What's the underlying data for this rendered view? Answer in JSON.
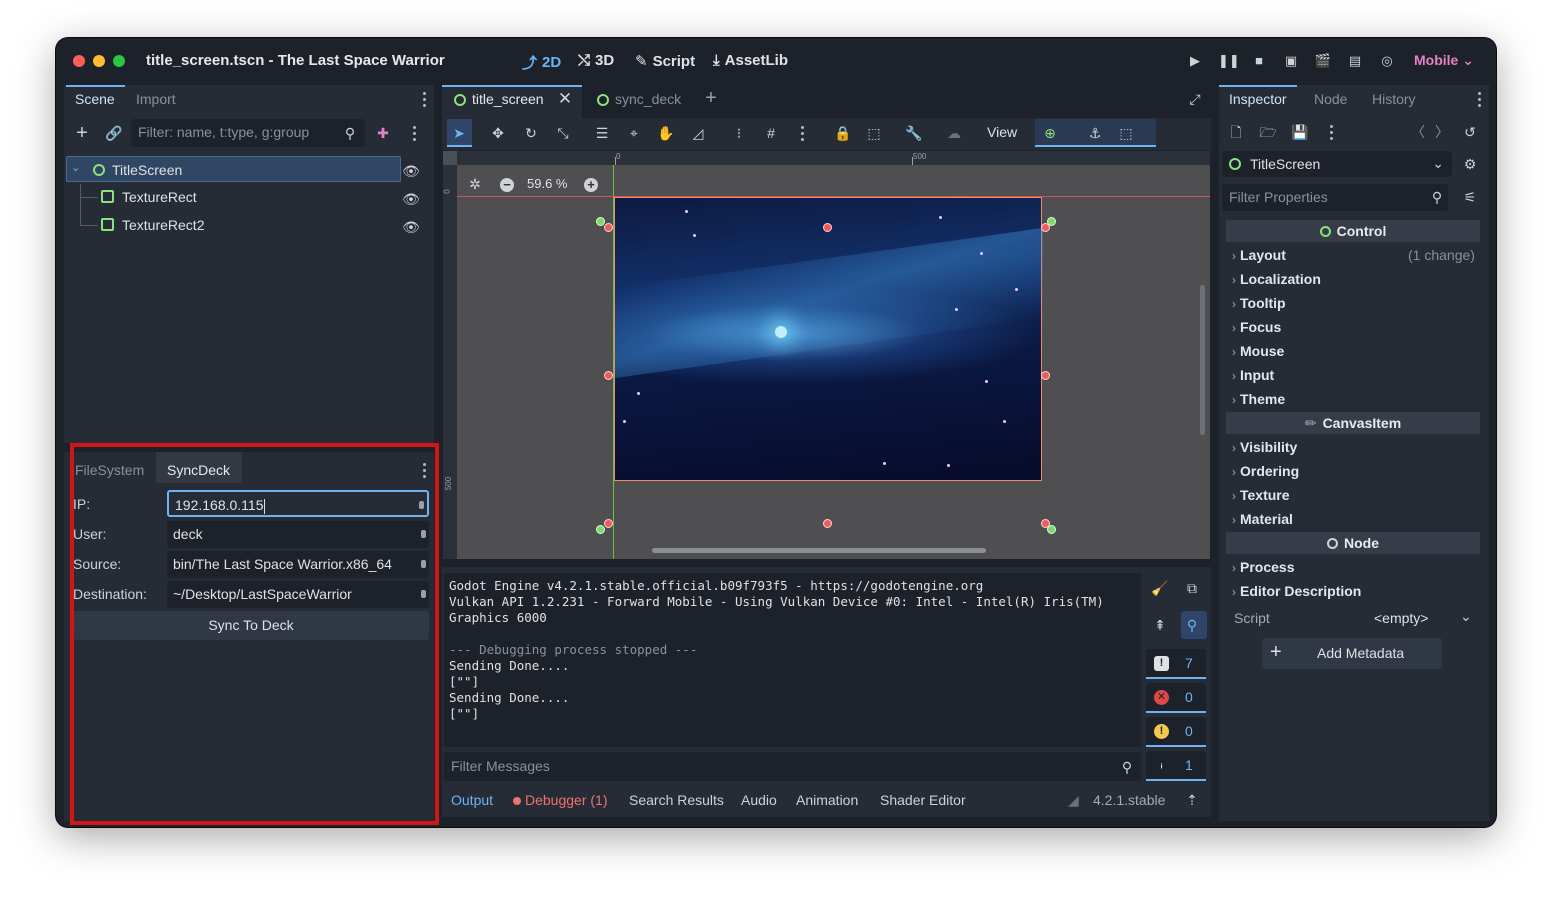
{
  "window": {
    "title": "title_screen.tscn - The Last Space Warrior",
    "traffic_colors": [
      "#ff5f57",
      "#febc2e",
      "#28c840"
    ]
  },
  "modes": {
    "m2d": "2D",
    "m3d": "3D",
    "script": "Script",
    "assetlib": "AssetLib"
  },
  "renderer": "Mobile",
  "scene_dock": {
    "tabs": [
      "Scene",
      "Import"
    ],
    "filter_placeholder": "Filter: name, t:type, g:group",
    "nodes": [
      {
        "name": "TitleScreen",
        "type": "control"
      },
      {
        "name": "TextureRect",
        "type": "texture"
      },
      {
        "name": "TextureRect2",
        "type": "texture"
      }
    ]
  },
  "syncdeck_dock": {
    "tabs": [
      "FileSystem",
      "SyncDeck"
    ],
    "fields": [
      {
        "label": "IP:",
        "value": "192.168.0.115"
      },
      {
        "label": "User:",
        "value": "deck"
      },
      {
        "label": "Source:",
        "value": "bin/The Last Space Warrior.x86_64"
      },
      {
        "label": "Destination:",
        "value": "~/Desktop/LastSpaceWarrior"
      }
    ],
    "button": "Sync To Deck"
  },
  "editor_tabs": [
    {
      "label": "title_screen"
    },
    {
      "label": "sync_deck"
    }
  ],
  "toolbar": {
    "view_label": "View"
  },
  "viewport": {
    "zoom": "59.6 %",
    "ruler_labels": [
      "0",
      "500"
    ],
    "vruler_labels": [
      "0",
      "500"
    ]
  },
  "output": {
    "lines": [
      "Godot Engine v4.2.1.stable.official.b09f793f5 - https://godotengine.org",
      "Vulkan API 1.2.231 - Forward Mobile - Using Vulkan Device #0: Intel - Intel(R) Iris(TM)",
      "Graphics 6000",
      "",
      "--- Debugging process stopped ---",
      "Sending Done....",
      "[\"\"]",
      "Sending Done....",
      "[\"\"]"
    ],
    "filter_placeholder": "Filter Messages",
    "counters": [
      {
        "icon": "message-icon",
        "value": "7"
      },
      {
        "icon": "error-icon",
        "value": "0"
      },
      {
        "icon": "warning-icon",
        "value": "0"
      },
      {
        "icon": "info-icon",
        "value": "1"
      }
    ]
  },
  "bottom_tabs": {
    "output": "Output",
    "debugger": "Debugger (1)",
    "search": "Search Results",
    "audio": "Audio",
    "animation": "Animation",
    "shader": "Shader Editor",
    "version": "4.2.1.stable"
  },
  "inspector": {
    "tabs": [
      "Inspector",
      "Node",
      "History"
    ],
    "node_name": "TitleScreen",
    "filter_placeholder": "Filter Properties",
    "section_control": "Control",
    "control_props": [
      {
        "name": "Layout",
        "note": "(1 change)"
      },
      {
        "name": "Localization",
        "note": ""
      },
      {
        "name": "Tooltip",
        "note": ""
      },
      {
        "name": "Focus",
        "note": ""
      },
      {
        "name": "Mouse",
        "note": ""
      },
      {
        "name": "Input",
        "note": ""
      },
      {
        "name": "Theme",
        "note": ""
      }
    ],
    "section_canvas": "CanvasItem",
    "canvas_props": [
      "Visibility",
      "Ordering",
      "Texture",
      "Material"
    ],
    "section_node": "Node",
    "node_props": [
      "Process",
      "Editor Description"
    ],
    "script_label": "Script",
    "script_value": "<empty>",
    "add_metadata": "Add Metadata"
  },
  "colors": {
    "accent": "#6fb3f2",
    "highlight_box": "#d11616",
    "renderer": "#e281c5"
  }
}
